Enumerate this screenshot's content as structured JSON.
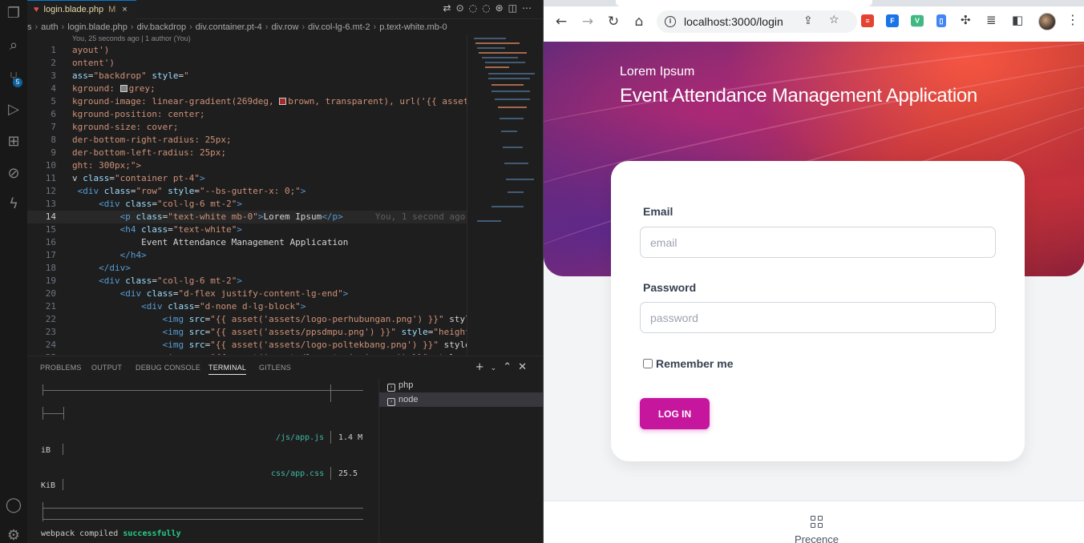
{
  "editor": {
    "tab": {
      "icon": "laravel-icon",
      "title": "login.blade.php",
      "modified": "M",
      "close": "×"
    },
    "breadcrumb": [
      "s",
      "auth",
      "login.blade.php",
      "div.backdrop",
      "div.container.pt-4",
      "div.row",
      "div.col-lg-6.mt-2",
      "p.text-white.mb-0"
    ],
    "blame_header": "You, 25 seconds ago | 1 author (You)",
    "active_line_blame": "You, 1 second ago •",
    "lines": [
      {
        "n": "1",
        "text": "ayout')"
      },
      {
        "n": "2",
        "text": "ontent')"
      },
      {
        "n": "3",
        "text": "ass=\"backdrop\" style=\""
      },
      {
        "n": "4",
        "pre": "kground: ",
        "post": "grey;",
        "swatch": "#808080"
      },
      {
        "n": "5",
        "pre": "kground-image: linear-gradient(269deg, ",
        "post": "brown, transparent), url('{{ asset(",
        "swatch": "#a52a2a"
      },
      {
        "n": "6",
        "text": "kground-position: center;"
      },
      {
        "n": "7",
        "text": "kground-size: cover;"
      },
      {
        "n": "8",
        "text": "der-bottom-right-radius: 25px;"
      },
      {
        "n": "9",
        "text": "der-bottom-left-radius: 25px;"
      },
      {
        "n": "10",
        "text": "ght: 300px;\">"
      },
      {
        "n": "11",
        "text": "v class=\"container pt-4\">"
      },
      {
        "n": "12",
        "text": " <div class=\"row\" style=\"--bs-gutter-x: 0;\">"
      },
      {
        "n": "13",
        "text": "     <div class=\"col-lg-6 mt-2\">"
      },
      {
        "n": "14",
        "text": "         <p class=\"text-white mb-0\">Lorem Ipsum</p>"
      },
      {
        "n": "15",
        "text": "         <h4 class=\"text-white\">"
      },
      {
        "n": "16",
        "text": "             Event Attendance Management Application"
      },
      {
        "n": "17",
        "text": "         </h4>"
      },
      {
        "n": "18",
        "text": "     </div>"
      },
      {
        "n": "19",
        "text": "     <div class=\"col-lg-6 mt-2\">"
      },
      {
        "n": "20",
        "text": "         <div class=\"d-flex justify-content-lg-end\">"
      },
      {
        "n": "21",
        "text": "             <div class=\"d-none d-lg-block\">"
      },
      {
        "n": "22",
        "text": "                 <img src=\"{{ asset('assets/logo-perhubungan.png') }}\" style="
      },
      {
        "n": "23",
        "text": "                 <img src=\"{{ asset('assets/ppsdmpu.png') }}\" style=\"height:"
      },
      {
        "n": "24",
        "text": "                 <img src=\"{{ asset('assets/logo-poltekbang.png') }}\" style='"
      },
      {
        "n": "25",
        "text": "                 <img src=\"{{ asset('assets/logo-tnainain.png') }}\" style=\"h"
      }
    ]
  },
  "panel": {
    "tabs": [
      "PROBLEMS",
      "OUTPUT",
      "DEBUG CONSOLE",
      "TERMINAL",
      "GITLENS"
    ],
    "active_tab": "TERMINAL",
    "terminal": {
      "js_file": "/js/app.js",
      "js_size": "1.4 M",
      "js_unit": "iB",
      "css_file": "css/app.css",
      "css_size": "25.5",
      "css_unit": "KiB",
      "compiled_prefix": "webpack compiled",
      "compiled_status": "successfully"
    },
    "terminals": [
      {
        "name": "php",
        "active": false
      },
      {
        "name": "node",
        "active": true
      }
    ]
  },
  "browser": {
    "url": "localhost:3000/login",
    "hero": {
      "subtitle": "Lorem Ipsum",
      "title": "Event Attendance Management Application"
    },
    "form": {
      "email_label": "Email",
      "email_placeholder": "email",
      "password_label": "Password",
      "password_placeholder": "password",
      "remember_label": "Remember me",
      "login_label": "LOG IN"
    },
    "bottom_nav": {
      "icon": "grid-icon",
      "label": "Precence"
    },
    "colors": {
      "accent": "#c5169d",
      "hero_red": "#c0392b",
      "hero_purple": "#5a2a7a"
    }
  }
}
